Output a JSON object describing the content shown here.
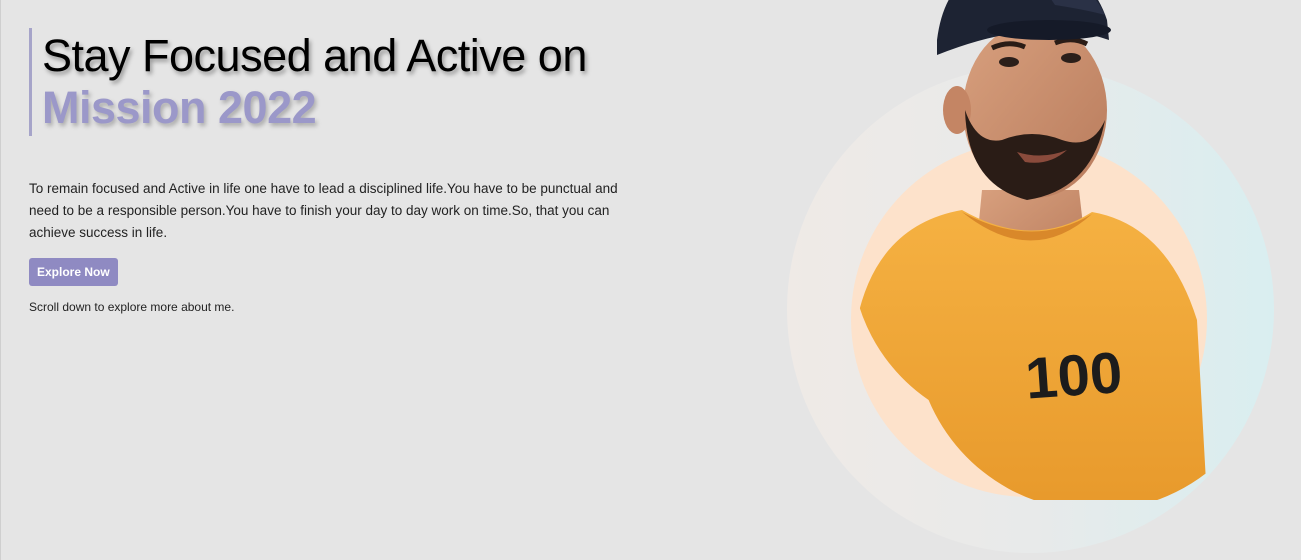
{
  "hero": {
    "headline_line1": "Stay Focused and Active on",
    "headline_line2": "Mission 2022",
    "description": "To remain focused and Active in life one have to lead a disciplined life.You have to be punctual and need to be a responsible person.You have to finish your day to day work on time.So, that you can achieve success in life.",
    "cta_label": "Explore Now",
    "scroll_hint": "Scroll down to explore more about me."
  },
  "portrait": {
    "shirt_text": "100"
  },
  "colors": {
    "background": "#e5e5e5",
    "accent": "#9b98c9",
    "button": "#8f8ac2",
    "circle_fill": "#fde2cb",
    "shirt": "#f2a93b"
  }
}
